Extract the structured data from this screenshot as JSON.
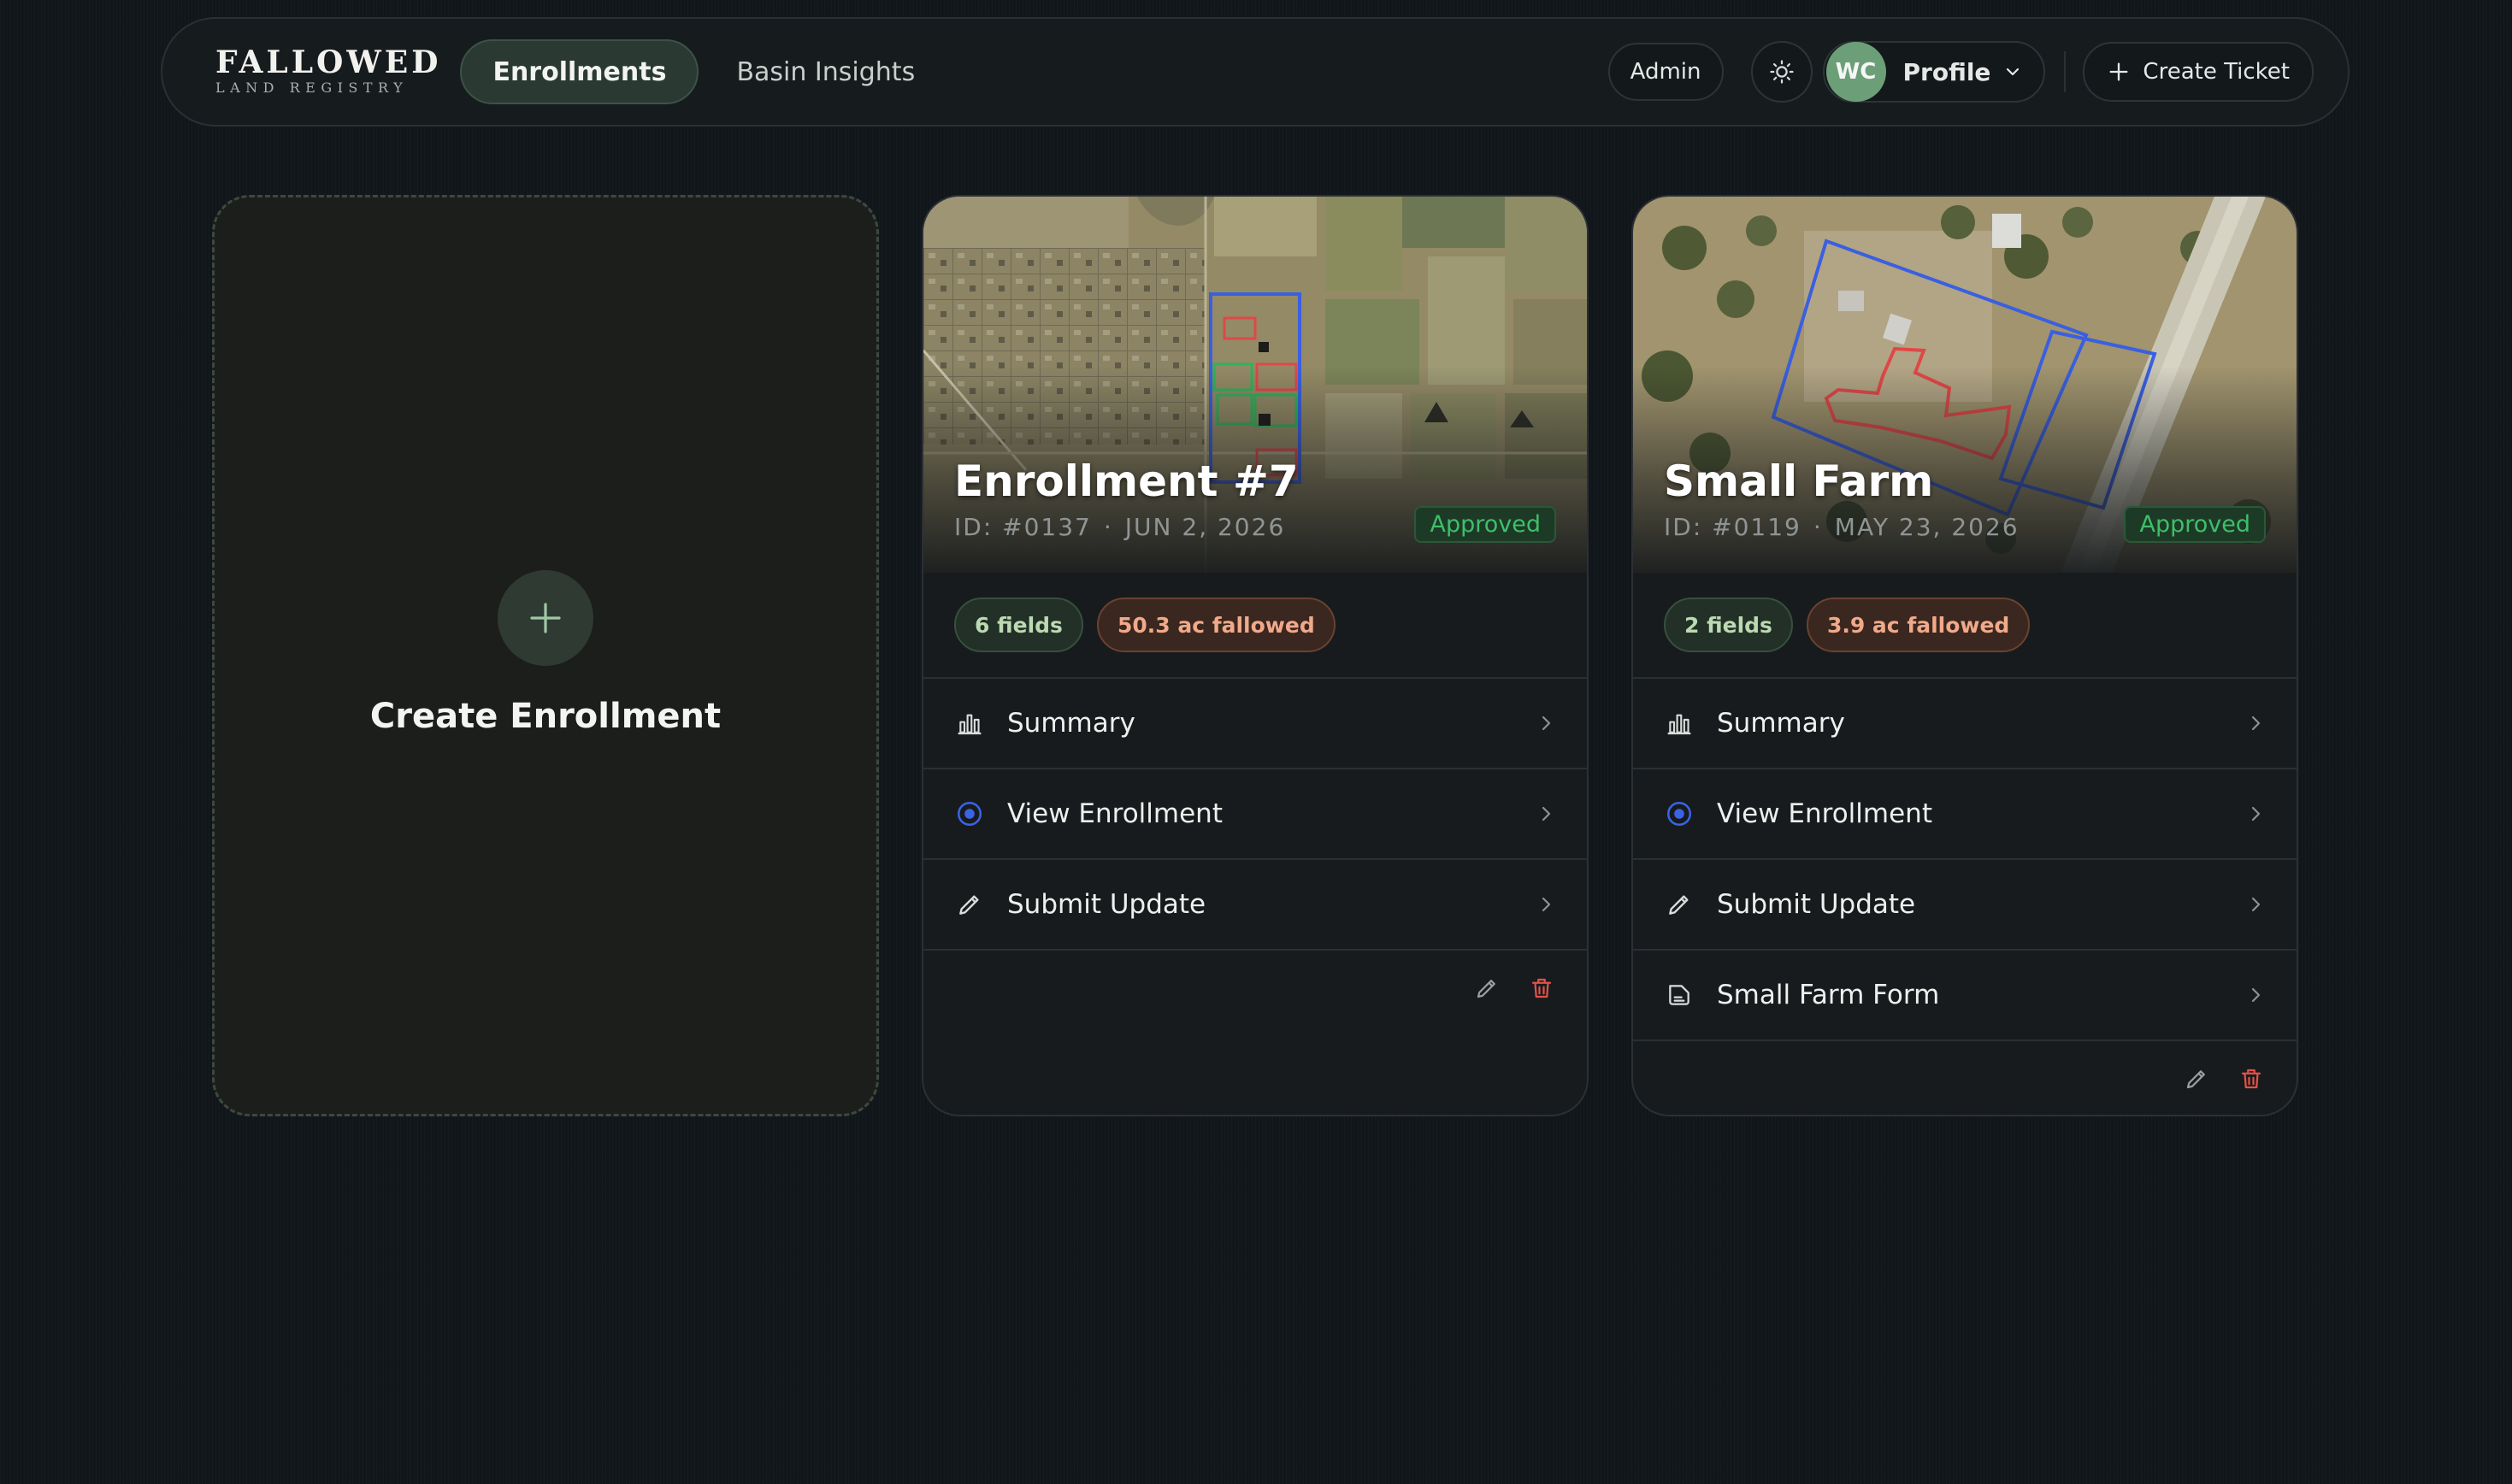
{
  "brand": {
    "name": "FALLOWED",
    "tagline": "LAND REGISTRY"
  },
  "nav": {
    "tabs": [
      {
        "label": "Enrollments",
        "active": true
      },
      {
        "label": "Basin Insights",
        "active": false
      }
    ]
  },
  "header": {
    "admin_label": "Admin",
    "profile_initials": "WC",
    "profile_label": "Profile",
    "create_ticket_label": "Create Ticket"
  },
  "create_card": {
    "label": "Create Enrollment"
  },
  "enrollments": [
    {
      "title": "Enrollment #7",
      "id": "ID: #0137",
      "date": "JUN 2, 2026",
      "status": "Approved",
      "fields_chip": "6 fields",
      "acres_chip": "50.3 ac fallowed",
      "actions": [
        {
          "label": "Summary",
          "icon": "bar-chart-icon"
        },
        {
          "label": "View Enrollment",
          "icon": "eye-icon"
        },
        {
          "label": "Submit Update",
          "icon": "pencil-icon"
        }
      ]
    },
    {
      "title": "Small Farm",
      "id": "ID: #0119",
      "date": "MAY 23, 2026",
      "status": "Approved",
      "fields_chip": "2 fields",
      "acres_chip": "3.9 ac fallowed",
      "actions": [
        {
          "label": "Summary",
          "icon": "bar-chart-icon"
        },
        {
          "label": "View Enrollment",
          "icon": "eye-icon"
        },
        {
          "label": "Submit Update",
          "icon": "pencil-icon"
        },
        {
          "label": "Small Farm Form",
          "icon": "document-icon"
        }
      ]
    }
  ],
  "colors": {
    "accent_green": "#3fbf6a",
    "danger_red": "#e0524a",
    "boundary_blue": "#3a5fe0",
    "field_green": "#2fb35a",
    "field_red": "#e04848"
  }
}
